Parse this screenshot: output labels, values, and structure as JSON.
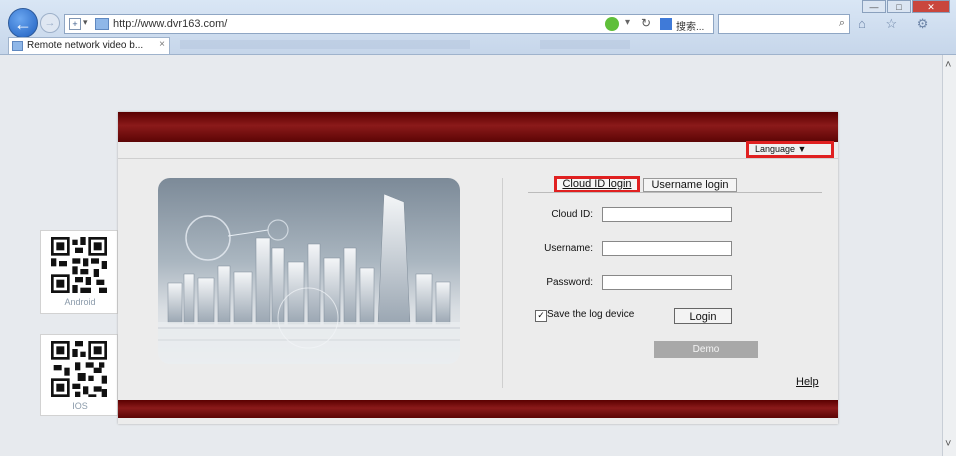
{
  "browser": {
    "url": "http://www.dvr163.com/",
    "search_engine_label": "搜索...",
    "tab_title": "Remote network video b...",
    "tab_close": "×",
    "back_glyph": "←",
    "forward_glyph": "→",
    "refresh_glyph": "↻",
    "search_glyph": "⌕",
    "toolbar_icons": "⌂ ☆ ⚙",
    "window_buttons": [
      "—",
      "□",
      "✕"
    ]
  },
  "page": {
    "language_label": "Language ▼",
    "login_tabs": [
      "Cloud ID login",
      "Username login"
    ],
    "fields": [
      {
        "label": "Cloud ID:",
        "value": ""
      },
      {
        "label": "Username:",
        "value": ""
      },
      {
        "label": "Password:",
        "value": ""
      }
    ],
    "save_device_label": "Save the log device",
    "save_device_checked": true,
    "login_button": "Login",
    "demo_button": "Demo",
    "help_link": "Help",
    "qr_android_label": "Android",
    "qr_ios_label": "IOS"
  },
  "colors": {
    "brand_band": "#8b1a1a",
    "highlight_border": "#e02020"
  }
}
